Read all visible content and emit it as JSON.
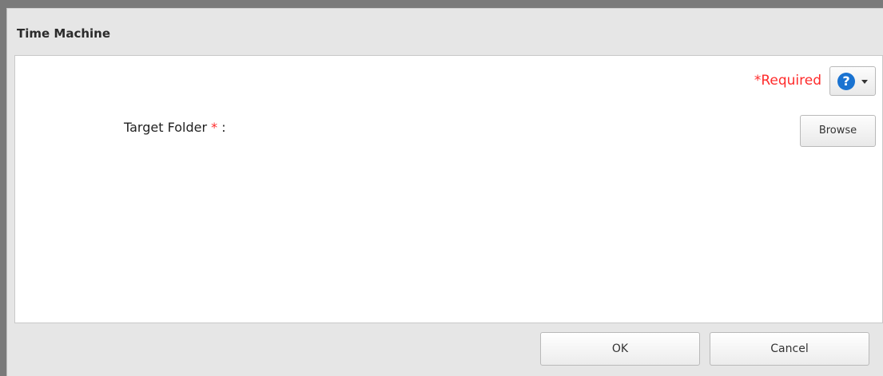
{
  "dialog": {
    "title": "Time Machine",
    "required_note": "*Required",
    "help_icon_glyph": "?",
    "help_icon": "question-circle-icon",
    "dropdown_icon": "caret-down-icon",
    "colors": {
      "required": "#ff2b2b",
      "help_icon": "#1a73d1",
      "dialog_background": "#e6e6e6",
      "content_background": "#ffffff"
    }
  },
  "form": {
    "target_folder_label": "Target Folder",
    "required_marker": "*",
    "label_separator": ":",
    "browse_label": "Browse"
  },
  "footer": {
    "ok_label": "OK",
    "cancel_label": "Cancel"
  }
}
